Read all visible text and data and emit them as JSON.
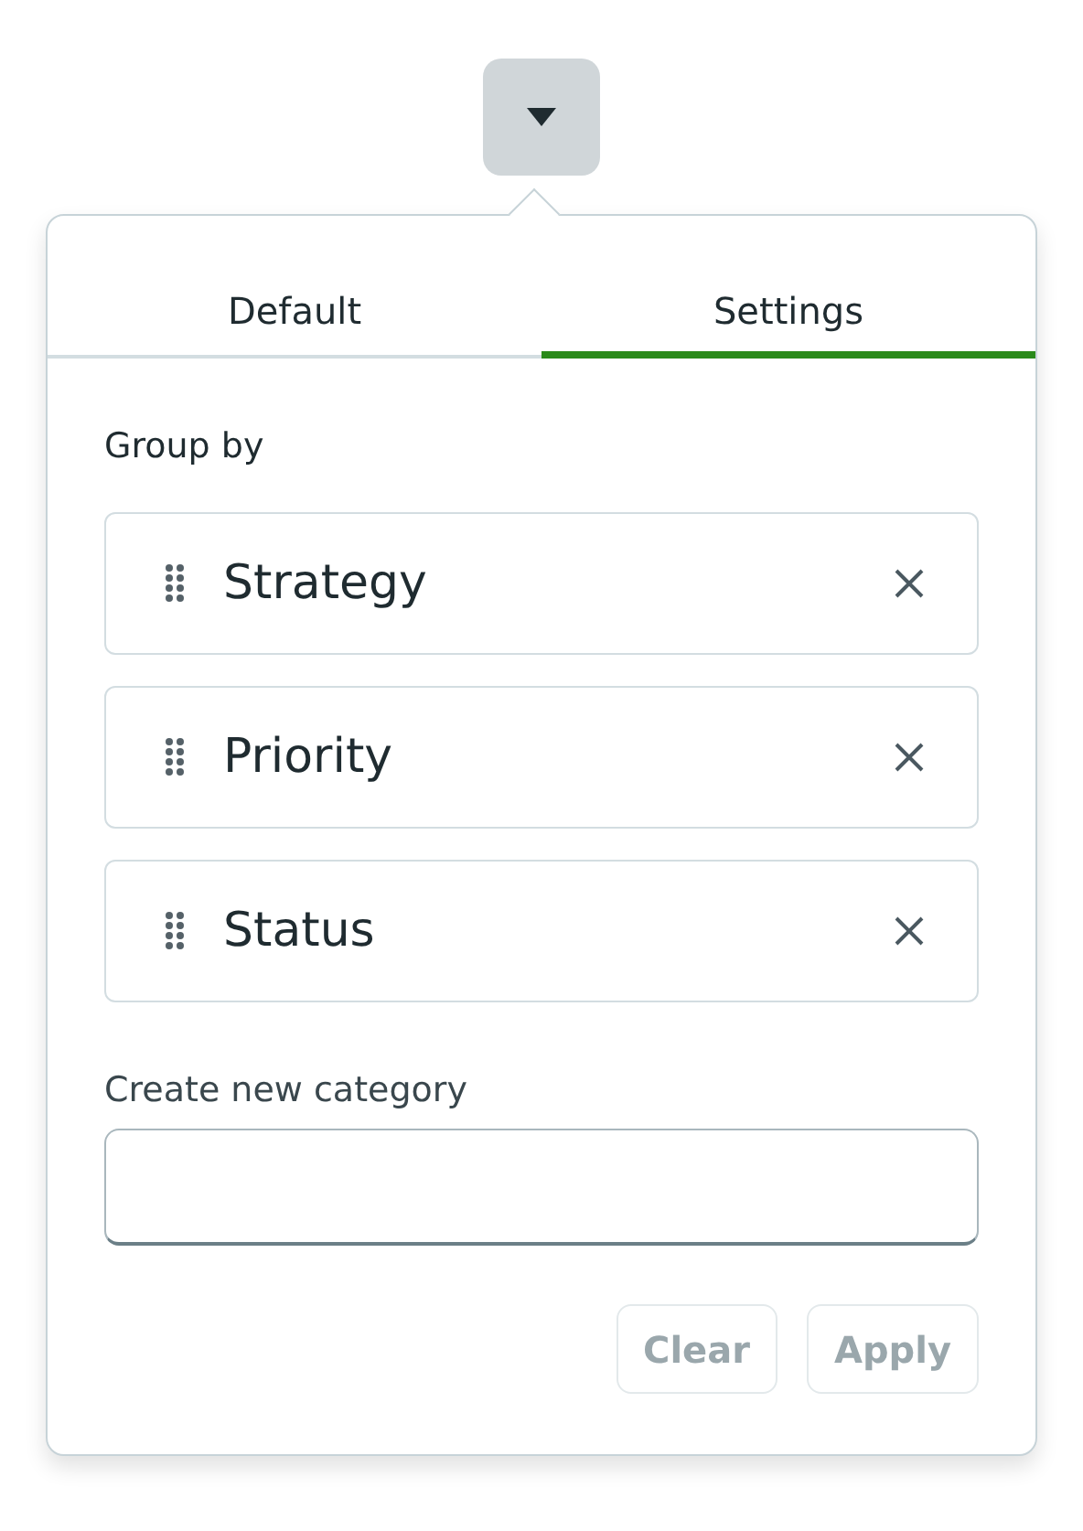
{
  "toggle_button": {
    "expanded": true
  },
  "tabs": [
    {
      "label": "Default",
      "selected": false
    },
    {
      "label": "Settings",
      "selected": true
    }
  ],
  "group_by": {
    "label": "Group by",
    "items": [
      {
        "label": "Strategy"
      },
      {
        "label": "Priority"
      },
      {
        "label": "Status"
      }
    ]
  },
  "new_category": {
    "label": "Create new category"
  },
  "buttons": [
    {
      "label": "Clear",
      "disabled": true
    },
    {
      "label": "Apply",
      "disabled": true
    }
  ]
}
